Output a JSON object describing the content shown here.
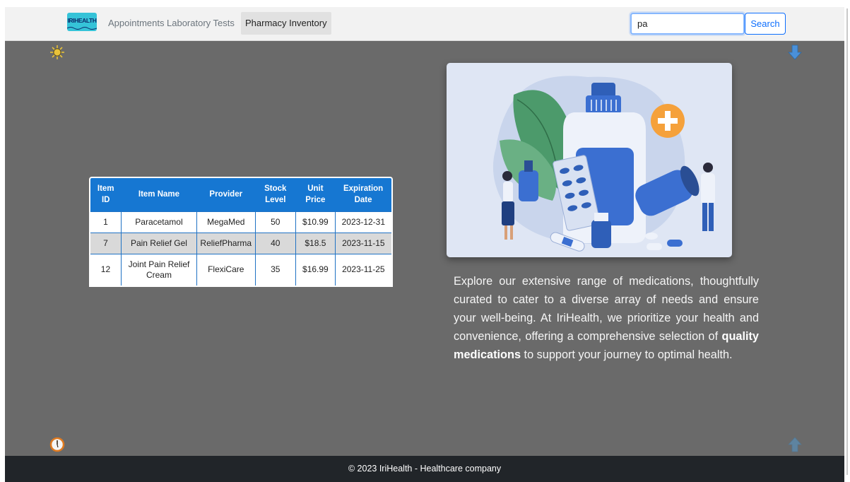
{
  "navbar": {
    "logo_text": "IRIHEALTH",
    "links": [
      {
        "label": "Appointments",
        "active": false
      },
      {
        "label": "Laboratory Tests",
        "active": false
      },
      {
        "label": "Pharmacy Inventory",
        "active": true
      }
    ],
    "search_value": "pa",
    "search_button": "Search"
  },
  "icons": {
    "top_left": "sun-icon",
    "top_right": "arrow-down-icon",
    "bottom_left": "clock-icon",
    "bottom_right": "arrow-up-icon"
  },
  "table": {
    "headers": [
      "Item ID",
      "Item Name",
      "Provider",
      "Stock Level",
      "Unit Price",
      "Expiration Date"
    ],
    "rows": [
      {
        "id": "1",
        "name": "Paracetamol",
        "provider": "MegaMed",
        "stock": "50",
        "price": "$10.99",
        "expiration": "2023-12-31"
      },
      {
        "id": "7",
        "name": "Pain Relief Gel",
        "provider": "ReliefPharma",
        "stock": "40",
        "price": "$18.5",
        "expiration": "2023-11-15"
      },
      {
        "id": "12",
        "name": "Joint Pain Relief Cream",
        "provider": "FlexiCare",
        "stock": "35",
        "price": "$16.99",
        "expiration": "2023-11-25"
      }
    ]
  },
  "description": {
    "part1": "Explore our extensive range of medications, thoughtfully curated to cater to a diverse array of needs and ensure your well-being. At IriHealth, we prioritize your health and convenience, offering a comprehensive selection of ",
    "bold": "quality medications",
    "part2": " to support your journey to optimal health."
  },
  "footer": {
    "text": "© 2023 IriHealth - Healthcare company"
  },
  "colors": {
    "table_header": "#1677d2",
    "main_bg": "#6a6a6a",
    "footer_bg": "#212529",
    "accent": "#0d6efd"
  }
}
